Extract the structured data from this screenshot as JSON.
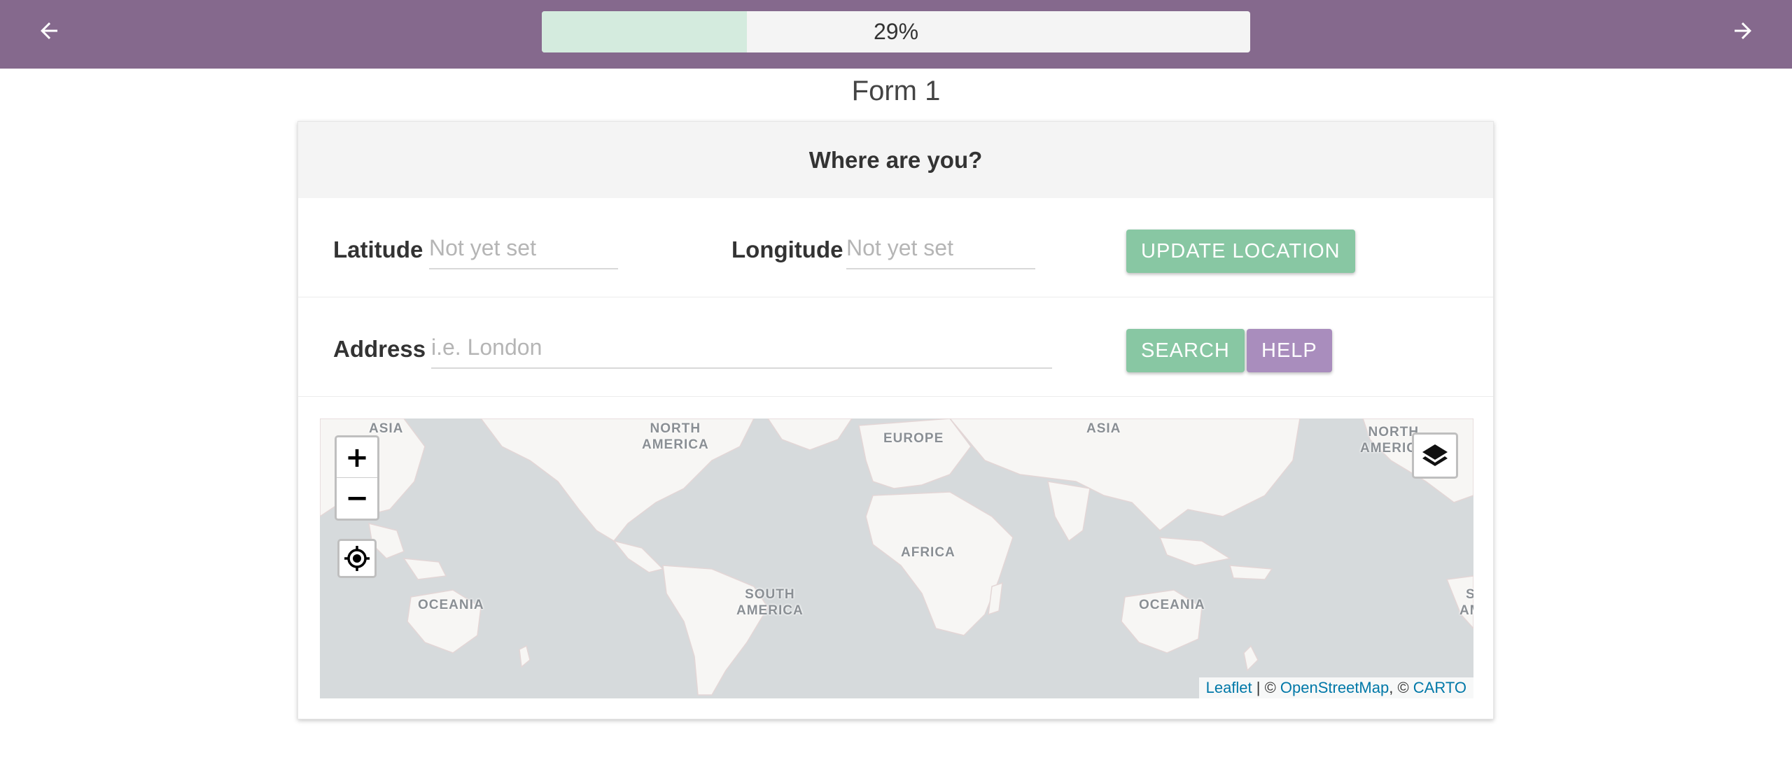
{
  "topbar": {
    "back_icon": "arrow-left-icon",
    "forward_icon": "arrow-right-icon",
    "progress_percent": 29,
    "progress_label": "29%",
    "bar_color": "#85698d",
    "progress_fill_color": "#d4ebde"
  },
  "form": {
    "title": "Form 1",
    "header": "Where are you?",
    "latitude": {
      "label": "Latitude",
      "value": "",
      "placeholder": "Not yet set"
    },
    "longitude": {
      "label": "Longitude",
      "value": "",
      "placeholder": "Not yet set"
    },
    "update_location_label": "UPDATE LOCATION",
    "address": {
      "label": "Address",
      "value": "",
      "placeholder": "i.e. London"
    },
    "search_label": "SEARCH",
    "help_label": "HELP",
    "accent_green": "#88c7a3",
    "accent_purple": "#a98dbd"
  },
  "map": {
    "labels": [
      "ASIA",
      "NORTH\nAMERICA",
      "EUROPE",
      "ASIA",
      "NORTH\nAMERICA",
      "AFRICA",
      "OCEANIA",
      "SOUTH\nAMERICA",
      "OCEANIA",
      "S\nAM"
    ],
    "zoom_in": "+",
    "zoom_out": "−",
    "locate_icon": "crosshair-icon",
    "layers_icon": "layers-icon",
    "attribution": {
      "leaflet": "Leaflet",
      "sep1": " | © ",
      "osm": "OpenStreetMap",
      "sep2": ", © ",
      "carto": "CARTO"
    }
  }
}
